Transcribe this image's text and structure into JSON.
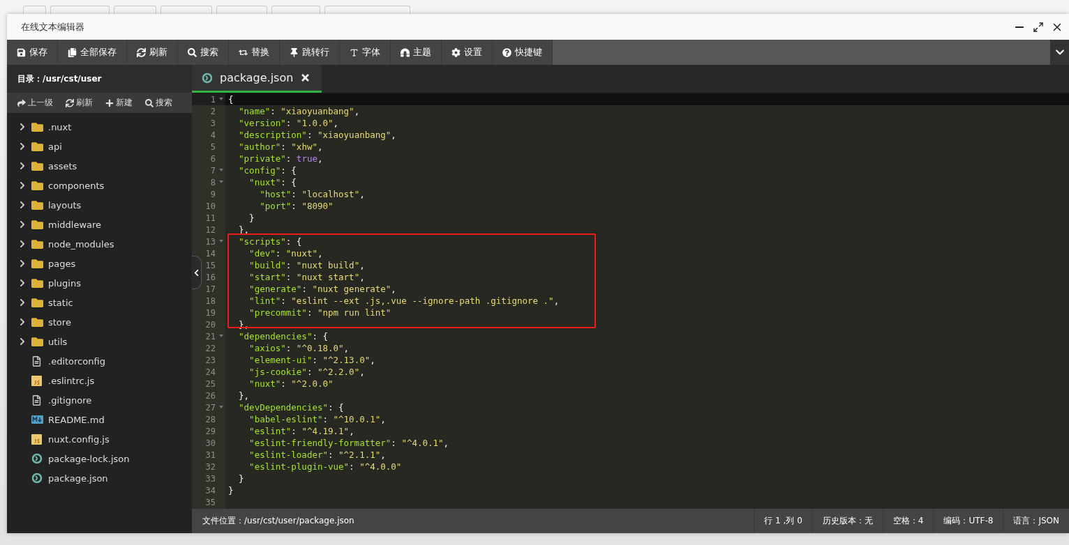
{
  "background_buttons": [
    {
      "kind": "blank"
    },
    {
      "kind": "blank"
    },
    {
      "kind": "blank"
    },
    {
      "kind": "blank"
    },
    {
      "kind": "blank"
    },
    {
      "kind": "blank"
    },
    {
      "kind": "blank"
    }
  ],
  "window": {
    "title": "在线文本编辑器"
  },
  "toolbar": [
    {
      "label": "保存"
    },
    {
      "label": "全部保存"
    },
    {
      "label": "刷新"
    },
    {
      "label": "搜索"
    },
    {
      "label": "替换"
    },
    {
      "label": "跳转行"
    },
    {
      "label": "字体"
    },
    {
      "label": "主题"
    },
    {
      "label": "设置"
    },
    {
      "label": "快捷键"
    }
  ],
  "sidebar": {
    "directory": "目录：/usr/cst/user",
    "actions": [
      {
        "label": "上一级"
      },
      {
        "label": "刷新"
      },
      {
        "label": "新建"
      },
      {
        "label": "搜索"
      }
    ],
    "items": [
      {
        "name": ".nuxt",
        "kind": "folder",
        "expanded": false
      },
      {
        "name": "api",
        "kind": "folder",
        "expanded": false
      },
      {
        "name": "assets",
        "kind": "folder",
        "expanded": false
      },
      {
        "name": "components",
        "kind": "folder",
        "expanded": false
      },
      {
        "name": "layouts",
        "kind": "folder",
        "expanded": false
      },
      {
        "name": "middleware",
        "kind": "folder",
        "expanded": false
      },
      {
        "name": "node_modules",
        "kind": "folder",
        "expanded": false
      },
      {
        "name": "pages",
        "kind": "folder",
        "expanded": false
      },
      {
        "name": "plugins",
        "kind": "folder",
        "expanded": false
      },
      {
        "name": "static",
        "kind": "folder",
        "expanded": false
      },
      {
        "name": "store",
        "kind": "folder",
        "expanded": false
      },
      {
        "name": "utils",
        "kind": "folder",
        "expanded": false
      },
      {
        "name": ".editorconfig",
        "kind": "text"
      },
      {
        "name": ".eslintrc.js",
        "kind": "js"
      },
      {
        "name": ".gitignore",
        "kind": "text"
      },
      {
        "name": "README.md",
        "kind": "markdown"
      },
      {
        "name": "nuxt.config.js",
        "kind": "js"
      },
      {
        "name": "package-lock.json",
        "kind": "json"
      },
      {
        "name": "package.json",
        "kind": "json"
      }
    ]
  },
  "tabs": [
    {
      "label": "package.json",
      "selected": true
    }
  ],
  "code": [
    {
      "number": "1",
      "text": "{",
      "foldable": true
    },
    {
      "number": "2",
      "text": "  \"name\": \"xiaoyuanbang\",",
      "foldable": false
    },
    {
      "number": "3",
      "text": "  \"version\": \"1.0.0\",",
      "foldable": false
    },
    {
      "number": "4",
      "text": "  \"description\": \"xiaoyuanbang\",",
      "foldable": false
    },
    {
      "number": "5",
      "text": "  \"author\": \"xhw\",",
      "foldable": false
    },
    {
      "number": "6",
      "text": "  \"private\": true,",
      "foldable": false
    },
    {
      "number": "7",
      "text": "  \"config\": {",
      "foldable": true
    },
    {
      "number": "8",
      "text": "    \"nuxt\": {",
      "foldable": true
    },
    {
      "number": "9",
      "text": "      \"host\": \"localhost\",",
      "foldable": false
    },
    {
      "number": "10",
      "text": "      \"port\": \"8090\"",
      "foldable": false
    },
    {
      "number": "11",
      "text": "    }",
      "foldable": false
    },
    {
      "number": "12",
      "text": "  },",
      "foldable": false
    },
    {
      "number": "13",
      "text": "  \"scripts\": {",
      "foldable": true
    },
    {
      "number": "14",
      "text": "    \"dev\": \"nuxt\",",
      "foldable": false
    },
    {
      "number": "15",
      "text": "    \"build\": \"nuxt build\",",
      "foldable": false
    },
    {
      "number": "16",
      "text": "    \"start\": \"nuxt start\",",
      "foldable": false
    },
    {
      "number": "17",
      "text": "    \"generate\": \"nuxt generate\",",
      "foldable": false
    },
    {
      "number": "18",
      "text": "    \"lint\": \"eslint --ext .js,.vue --ignore-path .gitignore .\",",
      "foldable": false
    },
    {
      "number": "19",
      "text": "    \"precommit\": \"npm run lint\"",
      "foldable": false
    },
    {
      "number": "20",
      "text": "  },",
      "foldable": false
    },
    {
      "number": "21",
      "text": "  \"dependencies\": {",
      "foldable": true
    },
    {
      "number": "22",
      "text": "    \"axios\": \"^0.18.0\",",
      "foldable": false
    },
    {
      "number": "23",
      "text": "    \"element-ui\": \"^2.13.0\",",
      "foldable": false
    },
    {
      "number": "24",
      "text": "    \"js-cookie\": \"^2.2.0\",",
      "foldable": false
    },
    {
      "number": "25",
      "text": "    \"nuxt\": \"^2.0.0\"",
      "foldable": false
    },
    {
      "number": "26",
      "text": "  },",
      "foldable": false
    },
    {
      "number": "27",
      "text": "  \"devDependencies\": {",
      "foldable": true
    },
    {
      "number": "28",
      "text": "    \"babel-eslint\": \"^10.0.1\",",
      "foldable": false
    },
    {
      "number": "29",
      "text": "    \"eslint\": \"^4.19.1\",",
      "foldable": false
    },
    {
      "number": "30",
      "text": "    \"eslint-friendly-formatter\": \"^4.0.1\",",
      "foldable": false
    },
    {
      "number": "31",
      "text": "    \"eslint-loader\": \"^2.1.1\",",
      "foldable": false
    },
    {
      "number": "32",
      "text": "    \"eslint-plugin-vue\": \"^4.0.0\"",
      "foldable": false
    },
    {
      "number": "33",
      "text": "  }",
      "foldable": false
    },
    {
      "number": "34",
      "text": "}",
      "foldable": false
    },
    {
      "number": "35",
      "foldable": false
    }
  ],
  "status_bar": {
    "file_location": "文件位置：/usr/cst/user/package.json",
    "items": [
      "行 1 ,列 0",
      "历史版本：无",
      "空格：4",
      "编码：UTF-8",
      "语言：JSON"
    ]
  }
}
